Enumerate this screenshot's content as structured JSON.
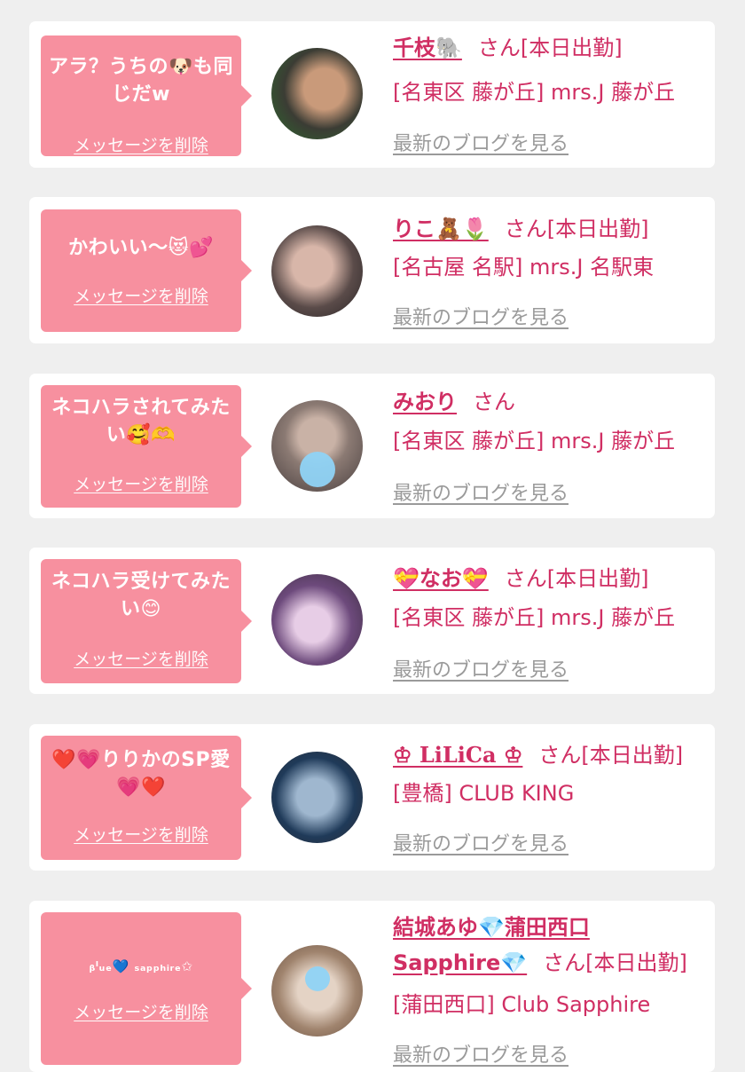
{
  "common": {
    "delete_label": "メッセージを削除",
    "blog_link": "最新のブログを見る",
    "san": "さん"
  },
  "cards": [
    {
      "message": "アラ？うちの🐶も同じだw",
      "name": "千枝🐘",
      "shift": "[本日出勤]",
      "location": "[名東区 藤が丘] mrs.J 藤が丘",
      "avatar_colors": [
        "#3b3c34",
        "#c99a7a",
        "#2e6a2f"
      ]
    },
    {
      "message": "かわいい〜😻💕",
      "name": "りこ🧸🌷",
      "shift": "[本日出勤]",
      "location": "[名古屋 名駅] mrs.J 名駅東",
      "avatar_colors": [
        "#5a4b49",
        "#d8b6a9",
        "#2a2526"
      ]
    },
    {
      "message": "ネコハラされてみたい🥰🫶",
      "name": "みおり",
      "shift": "",
      "location": "[名東区 藤が丘] mrs.J 藤が丘",
      "avatar_colors": [
        "#4a4040",
        "#c9b2a6",
        "#8b7a73"
      ]
    },
    {
      "message": "ネコハラ受けてみたい😊",
      "name": "💝なお💝",
      "shift": "[本日出勤]",
      "location": "[名東区 藤が丘] mrs.J 藤が丘",
      "avatar_colors": [
        "#6d4a7c",
        "#e7cde6",
        "#3b2c3e"
      ]
    },
    {
      "message": "❤️💗りりかのSP愛💗❤️",
      "name": "♔ LiLiCa ♔",
      "shift": "[本日出勤]",
      "location": "[豊橋] CLUB KING",
      "avatar_colors": [
        "#1f3a59",
        "#9fb7cf",
        "#2b2b33"
      ]
    },
    {
      "message": "ᵦˡᵤₑ💙 ₛₐₚₚₕᵢᵣₑ✩",
      "name_line1": "結城あゆ💎蒲田西口",
      "name_line2": "Sapphire💎",
      "shift": "[本日出勤]",
      "location": "[蒲田西口] Club Sapphire",
      "avatar_colors": [
        "#a0846e",
        "#e4d3c5",
        "#6b5243"
      ]
    }
  ]
}
